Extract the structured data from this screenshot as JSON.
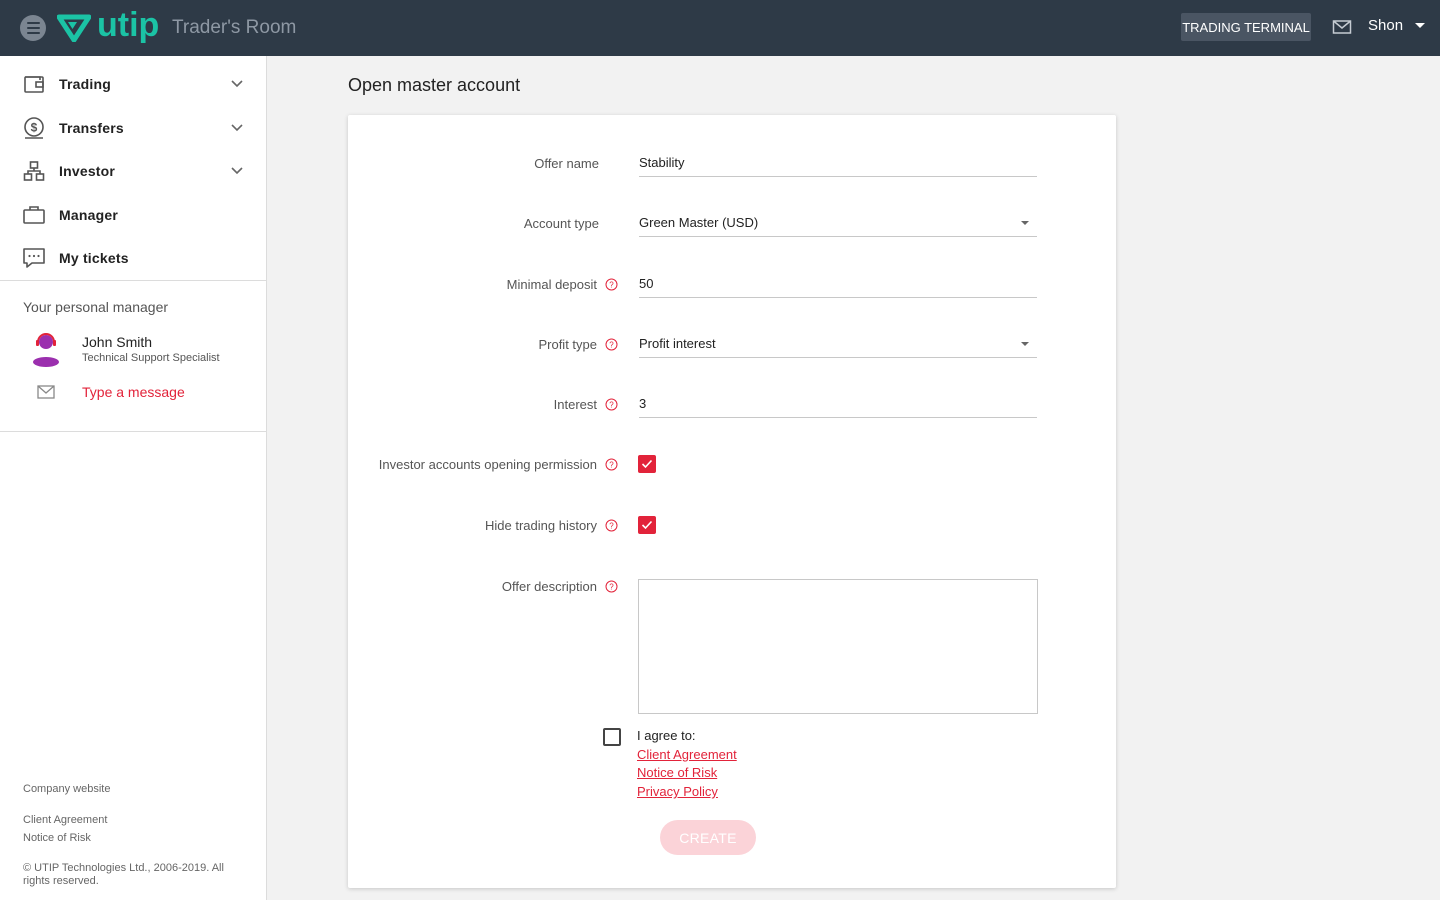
{
  "header": {
    "logo_text": "utip",
    "room_title": "Trader's Room",
    "terminal_button": "TRADING TERMINAL",
    "user_name": "Shon"
  },
  "sidebar": {
    "items": [
      {
        "label": "Trading",
        "icon": "wallet-icon",
        "expandable": true
      },
      {
        "label": "Transfers",
        "icon": "dollar-circle-icon",
        "expandable": true
      },
      {
        "label": "Investor",
        "icon": "hierarchy-icon",
        "expandable": true
      },
      {
        "label": "Manager",
        "icon": "briefcase-icon",
        "expandable": false
      },
      {
        "label": "My tickets",
        "icon": "chat-bubble-icon",
        "expandable": false
      }
    ],
    "personal_manager": {
      "title": "Your personal manager",
      "name": "John Smith",
      "role": "Technical Support Specialist",
      "message_link": "Type a message"
    },
    "footer": {
      "company_website": "Company website",
      "client_agreement": "Client Agreement",
      "notice_of_risk": "Notice of Risk",
      "copyright": "© UTIP Technologies Ltd., 2006-2019. All rights reserved."
    }
  },
  "main": {
    "page_title": "Open master account",
    "form": {
      "offer_name_label": "Offer name",
      "offer_name_value": "Stability",
      "account_type_label": "Account type",
      "account_type_value": "Green Master (USD)",
      "minimal_deposit_label": "Minimal deposit",
      "minimal_deposit_value": "50",
      "profit_type_label": "Profit type",
      "profit_type_value": "Profit interest",
      "interest_label": "Interest",
      "interest_value": "3",
      "investor_permission_label": "Investor accounts opening permission",
      "investor_permission_checked": true,
      "hide_history_label": "Hide trading history",
      "hide_history_checked": true,
      "offer_description_label": "Offer description",
      "offer_description_value": "",
      "agree_label": "I agree to:",
      "agree_checked": false,
      "client_agreement_link": "Client Agreement",
      "notice_of_risk_link": "Notice of Risk",
      "privacy_policy_link": "Privacy Policy",
      "create_button": "CREATE"
    }
  },
  "colors": {
    "header_bg": "#2e3a47",
    "brand": "#1bc3a5",
    "accent": "#e2233a",
    "create_disabled": "#fbd3d8"
  }
}
